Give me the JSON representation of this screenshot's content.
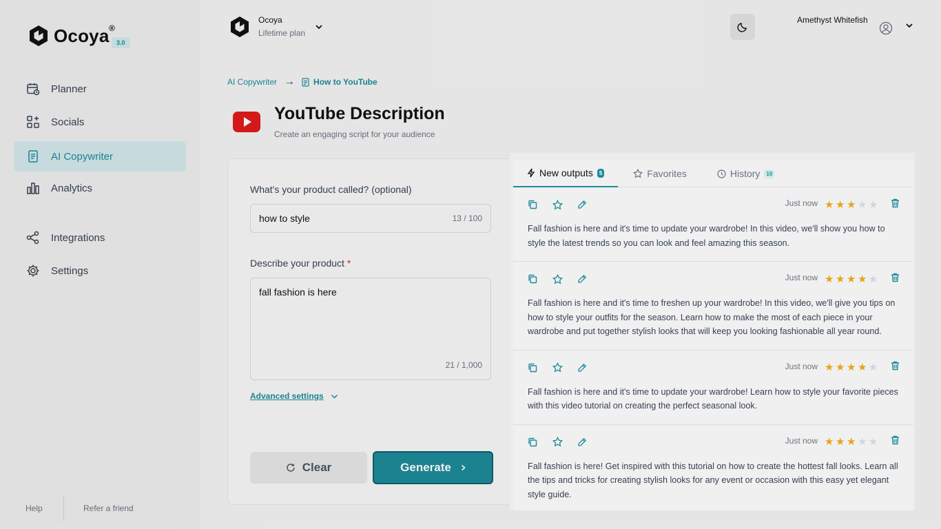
{
  "brand": {
    "name": "Ocoya",
    "reg": "®",
    "version": "3.0"
  },
  "sidebar": {
    "items": [
      {
        "label": "Planner",
        "icon": "calendar-icon"
      },
      {
        "label": "Socials",
        "icon": "apps-icon"
      },
      {
        "label": "AI Copywriter",
        "icon": "document-icon",
        "active": true
      },
      {
        "label": "Analytics",
        "icon": "bar-chart-icon"
      },
      {
        "label": "Integrations",
        "icon": "share-nodes-icon"
      },
      {
        "label": "Settings",
        "icon": "gear-icon"
      }
    ],
    "footer": {
      "help": "Help",
      "refer": "Refer a friend"
    }
  },
  "header": {
    "workspace_name": "Ocoya",
    "workspace_plan": "Lifetime plan",
    "user_name": "Amethyst Whitefish"
  },
  "breadcrumb": {
    "parent": "AI Copywriter",
    "arrow": "→",
    "current": "How to YouTube"
  },
  "page": {
    "title": "YouTube Description",
    "subtitle": "Create an engaging script for your audience"
  },
  "form": {
    "product_label": "What's your product called? (optional)",
    "product_value": "how to style",
    "product_counter": "13 / 100",
    "describe_label": "Describe your product",
    "required_mark": "*",
    "describe_value": "fall fashion is here",
    "describe_counter": "21 / 1,000",
    "advanced_label": "Advanced settings",
    "clear_label": "Clear",
    "generate_label": "Generate"
  },
  "results": {
    "tabs": [
      {
        "label": "New outputs",
        "count": "5",
        "active": true
      },
      {
        "label": "Favorites"
      },
      {
        "label": "History",
        "count": "10"
      }
    ],
    "accent": "#1d8a99",
    "star_color": "#e8a317",
    "outputs": [
      {
        "time": "Just now",
        "rating": 3,
        "text": "Fall fashion is here and it's time to update your wardrobe! In this video, we'll show you how to style the latest trends so you can look and feel amazing this season."
      },
      {
        "time": "Just now",
        "rating": 4,
        "text": "Fall fashion is here and it's time to freshen up your wardrobe! In this video, we'll give you tips on how to style your outfits for the season. Learn how to make the most of each piece in your wardrobe and put together stylish looks that will keep you looking fashionable all year round."
      },
      {
        "time": "Just now",
        "rating": 4,
        "text": "Fall fashion is here and it's time to update your wardrobe! Learn how to style your favorite pieces with this video tutorial on creating the perfect seasonal look."
      },
      {
        "time": "Just now",
        "rating": 3,
        "text": "Fall fashion is here! Get inspired with this tutorial on how to create the hottest fall looks. Learn all the tips and tricks for creating stylish looks for any event or occasion with this easy yet elegant style guide."
      }
    ]
  }
}
